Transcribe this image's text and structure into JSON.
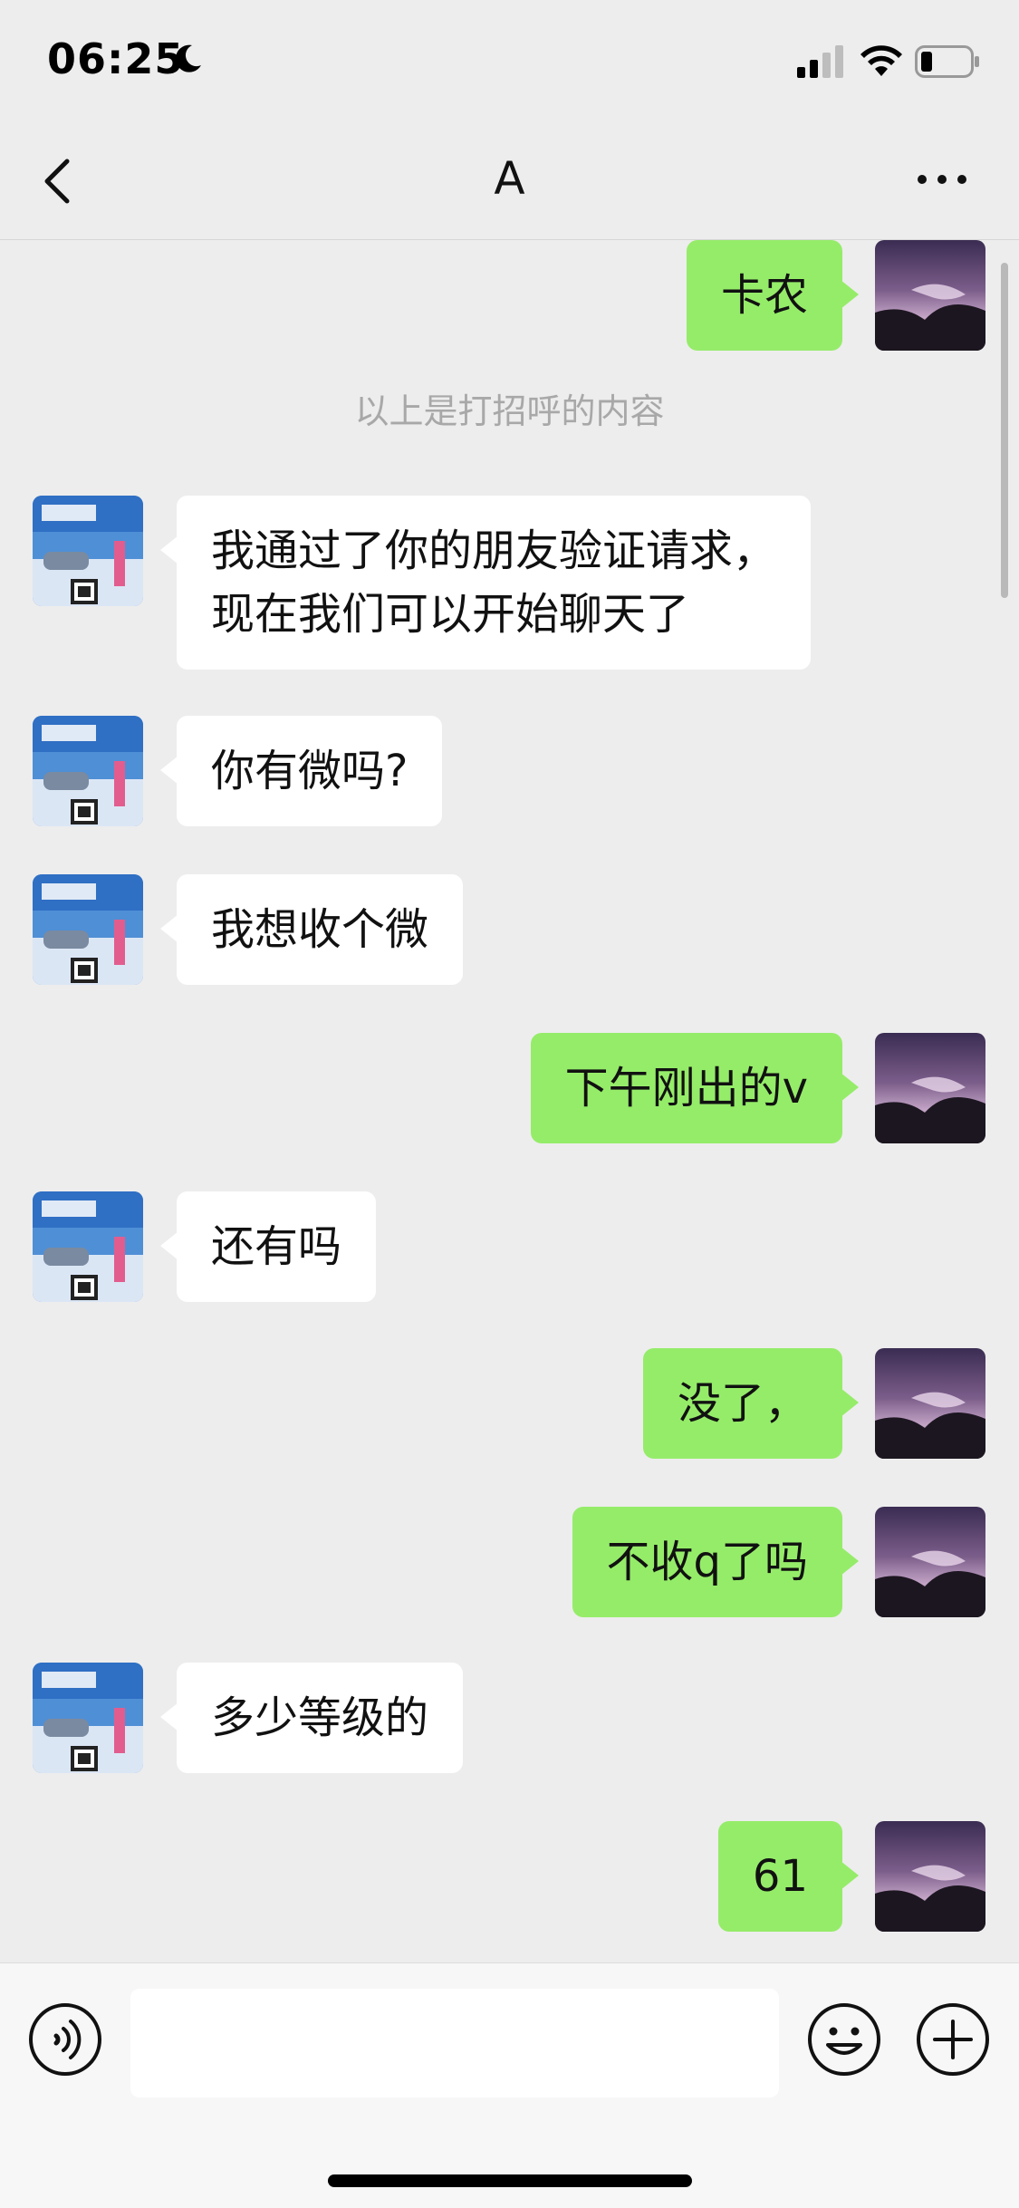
{
  "status_bar": {
    "time": "06:25"
  },
  "nav": {
    "title": "A"
  },
  "messages": [
    {
      "side": "me",
      "text": "卡农"
    },
    {
      "side": "system",
      "text": "以上是打招呼的内容"
    },
    {
      "side": "them",
      "text": "我通过了你的朋友验证请求，\n现在我们可以开始聊天了"
    },
    {
      "side": "them",
      "text": "你有微吗?"
    },
    {
      "side": "them",
      "text": "我想收个微"
    },
    {
      "side": "me",
      "text": "下午刚出的v"
    },
    {
      "side": "them",
      "text": "还有吗"
    },
    {
      "side": "me",
      "text": "没了，"
    },
    {
      "side": "me",
      "text": "不收q了吗"
    },
    {
      "side": "them",
      "text": "多少等级的"
    },
    {
      "side": "me",
      "text": "61"
    }
  ],
  "colors": {
    "my_bubble": "#95ec69",
    "their_bubble": "#ffffff",
    "background": "#ededed"
  },
  "icons": [
    "moon-icon",
    "signal-icon",
    "wifi-icon",
    "battery-icon",
    "back-arrow-icon",
    "more-dots-icon",
    "voice-icon",
    "emoji-icon",
    "plus-icon"
  ]
}
